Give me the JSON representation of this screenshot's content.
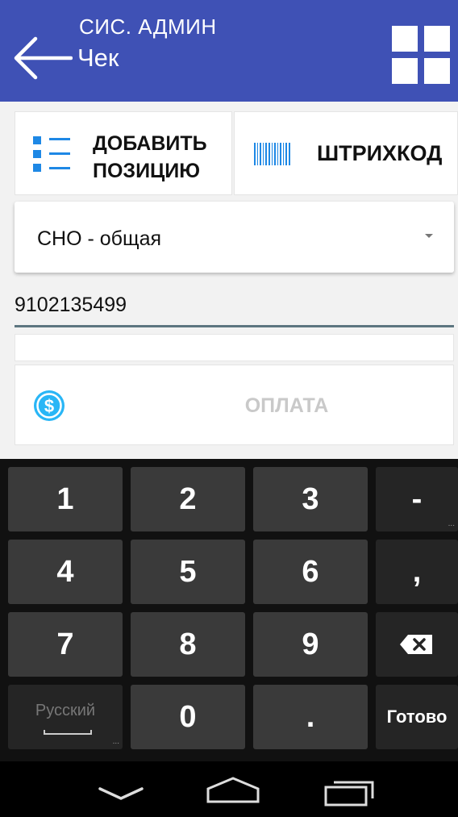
{
  "app_bar": {
    "subtitle": "СИС. АДМИН",
    "title": "Чек",
    "icons": {
      "back": "arrow-left-icon",
      "menu": "grid-icon"
    },
    "color": "#3f51b5"
  },
  "actions": {
    "add_position": "ДОБАВИТЬ\nПОЗИЦИЮ",
    "add_position_line1": "ДОБАВИТЬ",
    "add_position_line2": "ПОЗИЦИЮ",
    "barcode": "ШТРИХКОД",
    "icons": {
      "add_position": "list-icon",
      "barcode": "barcode-icon"
    },
    "accent": "#1e88e5"
  },
  "tax_system": {
    "selected": "СНО - общая"
  },
  "phone_input": {
    "value": "9102135499"
  },
  "payment": {
    "label": "ОПЛАТА",
    "icon": "dollar-coin-icon",
    "enabled": false
  },
  "keyboard": {
    "rows": [
      [
        "1",
        "2",
        "3",
        "-"
      ],
      [
        "4",
        "5",
        "6",
        ","
      ],
      [
        "7",
        "8",
        "9",
        "⌫"
      ],
      [
        "Русский",
        "0",
        ".",
        "Готово"
      ]
    ]
  },
  "nav_bar": {
    "icons": [
      "back-nav-icon",
      "home-nav-icon",
      "recents-nav-icon"
    ]
  }
}
